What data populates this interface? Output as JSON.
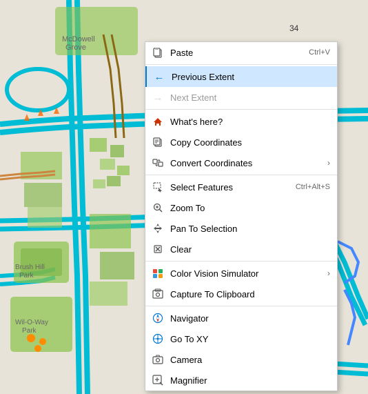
{
  "map": {
    "background_color": "#ddd9cc"
  },
  "context_menu": {
    "items": [
      {
        "id": "paste",
        "label": "Paste",
        "shortcut": "Ctrl+V",
        "icon": "paste-icon",
        "disabled": false,
        "has_arrow": false,
        "separator_after": false
      },
      {
        "id": "previous-extent",
        "label": "Previous Extent",
        "shortcut": "",
        "icon": "back-arrow-icon",
        "disabled": false,
        "active": true,
        "has_arrow": false,
        "separator_after": false
      },
      {
        "id": "next-extent",
        "label": "Next Extent",
        "shortcut": "",
        "icon": "forward-arrow-icon",
        "disabled": true,
        "has_arrow": false,
        "separator_after": true
      },
      {
        "id": "whats-here",
        "label": "What's here?",
        "shortcut": "",
        "icon": "house-icon",
        "disabled": false,
        "has_arrow": false,
        "separator_after": false
      },
      {
        "id": "copy-coordinates",
        "label": "Copy Coordinates",
        "shortcut": "",
        "icon": "copy-coords-icon",
        "disabled": false,
        "has_arrow": false,
        "separator_after": false
      },
      {
        "id": "convert-coordinates",
        "label": "Convert Coordinates",
        "shortcut": "",
        "icon": "convert-icon",
        "disabled": false,
        "has_arrow": true,
        "separator_after": true
      },
      {
        "id": "select-features",
        "label": "Select Features",
        "shortcut": "Ctrl+Alt+S",
        "icon": "select-icon",
        "disabled": false,
        "has_arrow": false,
        "separator_after": false
      },
      {
        "id": "zoom-to",
        "label": "Zoom To",
        "shortcut": "",
        "icon": "zoom-icon",
        "disabled": false,
        "has_arrow": false,
        "separator_after": false
      },
      {
        "id": "pan-to-selection",
        "label": "Pan To Selection",
        "shortcut": "",
        "icon": "pan-icon",
        "disabled": false,
        "has_arrow": false,
        "separator_after": false
      },
      {
        "id": "clear",
        "label": "Clear",
        "shortcut": "",
        "icon": "clear-icon",
        "disabled": false,
        "has_arrow": false,
        "separator_after": true
      },
      {
        "id": "color-vision",
        "label": "Color Vision Simulator",
        "shortcut": "",
        "icon": "vision-icon",
        "disabled": false,
        "has_arrow": true,
        "separator_after": false
      },
      {
        "id": "capture-clipboard",
        "label": "Capture To Clipboard",
        "shortcut": "",
        "icon": "capture-icon",
        "disabled": false,
        "has_arrow": false,
        "separator_after": true
      },
      {
        "id": "navigator",
        "label": "Navigator",
        "shortcut": "",
        "icon": "navigator-icon",
        "disabled": false,
        "has_arrow": false,
        "separator_after": false
      },
      {
        "id": "go-to-xy",
        "label": "Go To XY",
        "shortcut": "",
        "icon": "goto-icon",
        "disabled": false,
        "has_arrow": false,
        "separator_after": false
      },
      {
        "id": "camera",
        "label": "Camera",
        "shortcut": "",
        "icon": "camera-icon",
        "disabled": false,
        "has_arrow": false,
        "separator_after": false
      },
      {
        "id": "magnifier",
        "label": "Magnifier",
        "shortcut": "",
        "icon": "magnifier-icon",
        "disabled": false,
        "has_arrow": false,
        "separator_after": false
      }
    ]
  }
}
